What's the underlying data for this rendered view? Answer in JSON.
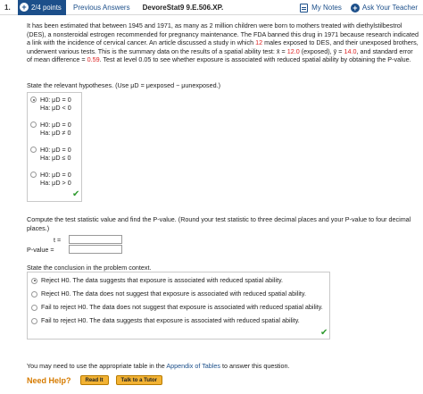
{
  "topbar": {
    "question_number": "1.",
    "points": "2/4 points",
    "previous_answers": "Previous Answers",
    "problem_id": "DevoreStat9 9.E.506.XP.",
    "my_notes": "My Notes",
    "ask_teacher": "Ask Your Teacher"
  },
  "problem": {
    "p1": "It has been estimated that between 1945 and 1971, as many as 2 million children were born to mothers treated with diethylstilbestrol (DES), a nonsteroidal estrogen recommended for pregnancy maintenance. The FDA banned this drug in 1971 because research indicated a link with the incidence of cervical cancer. An article discussed a study in which ",
    "n": "12",
    "p2": " males exposed to DES, and their unexposed brothers, underwent various tests. This is the summary data on the results of a spatial ability test: ",
    "xbar_label": "x̄ = ",
    "xbar_val": "12.0",
    "p3": " (exposed), ",
    "ybar_label": "ȳ = ",
    "ybar_val": "14.0",
    "p4": ", and standard error of mean difference = ",
    "se_val": "0.59",
    "p5": ". Test at level 0.05 to see whether exposure is associated with reduced spatial ability by obtaining the P-value."
  },
  "hypotheses": {
    "prompt": "State the relevant hypotheses. (Use μD = μexposed − μunexposed.)",
    "options": [
      {
        "h0": "H0: μD = 0",
        "ha": "Ha: μD < 0",
        "selected": true
      },
      {
        "h0": "H0: μD = 0",
        "ha": "Ha: μD ≠ 0",
        "selected": false
      },
      {
        "h0": "H0: μD = 0",
        "ha": "Ha: μD ≤ 0",
        "selected": false
      },
      {
        "h0": "H0: μD = 0",
        "ha": "Ha: μD > 0",
        "selected": false
      }
    ]
  },
  "compute": {
    "prompt": "Compute the test statistic value and find the P-value. (Round your test statistic to three decimal places and your P-value to four decimal places.)",
    "t_label": "t =",
    "p_label": "P-value ="
  },
  "conclusion": {
    "prompt": "State the conclusion in the problem context.",
    "options": [
      {
        "text": "Reject H0. The data suggests that exposure is associated with reduced spatial ability.",
        "selected": true
      },
      {
        "text": "Reject H0. The data does not suggest that exposure is associated with reduced spatial ability.",
        "selected": false
      },
      {
        "text": "Fail to reject H0. The data does not suggest that exposure is associated with reduced spatial ability.",
        "selected": false
      },
      {
        "text": "Fail to reject H0. The data suggests that exposure is associated with reduced spatial ability.",
        "selected": false
      }
    ]
  },
  "footer": {
    "table_note_pre": "You may need to use the appropriate table in the ",
    "appendix_link": "Appendix of Tables",
    "table_note_post": " to answer this question.",
    "need_help": "Need Help?",
    "read_it": "Read It",
    "talk_tutor": "Talk to a Tutor"
  },
  "colors": {
    "accent": "#1c4f8a",
    "highlight": "#dd2222",
    "check": "#2e9b2e",
    "help": "#d67b00"
  }
}
